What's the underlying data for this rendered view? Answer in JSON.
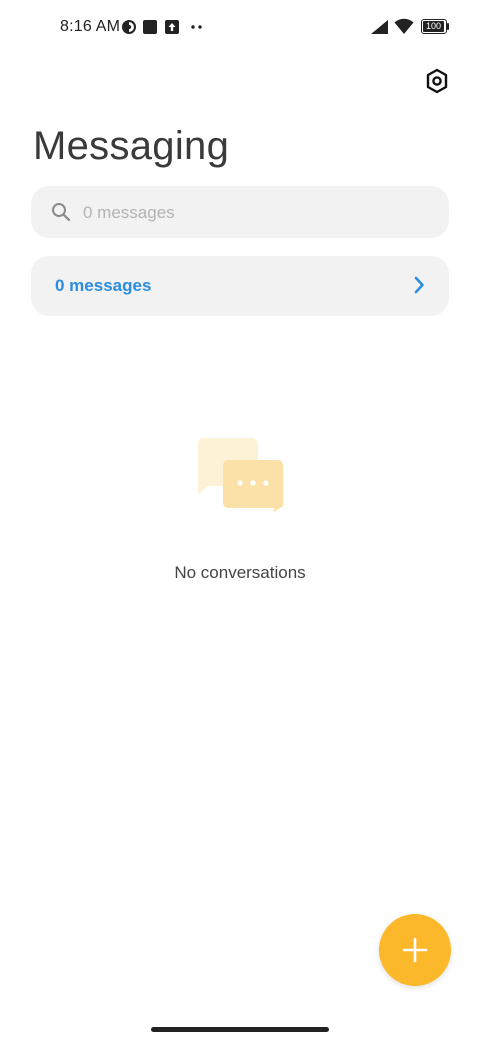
{
  "status_bar": {
    "time": "8:16 AM",
    "battery": "100",
    "left_icons": [
      "data-saver-icon",
      "square-notification-icon",
      "upload-icon",
      "more-dots-icon"
    ],
    "right_icons": [
      "cell-signal-icon",
      "wifi-icon",
      "battery-icon"
    ]
  },
  "header": {
    "title": "Messaging",
    "settings_icon": "settings-gear-icon"
  },
  "search": {
    "placeholder": "0 messages",
    "value": ""
  },
  "messages_row": {
    "label": "0 messages"
  },
  "empty_state": {
    "text": "No conversations",
    "illustration": "chat-bubbles-icon"
  },
  "fab": {
    "icon": "plus-icon"
  },
  "colors": {
    "accent_blue": "#2a8de0",
    "fab_yellow": "#fbb82a",
    "surface_gray": "#f2f2f2"
  }
}
